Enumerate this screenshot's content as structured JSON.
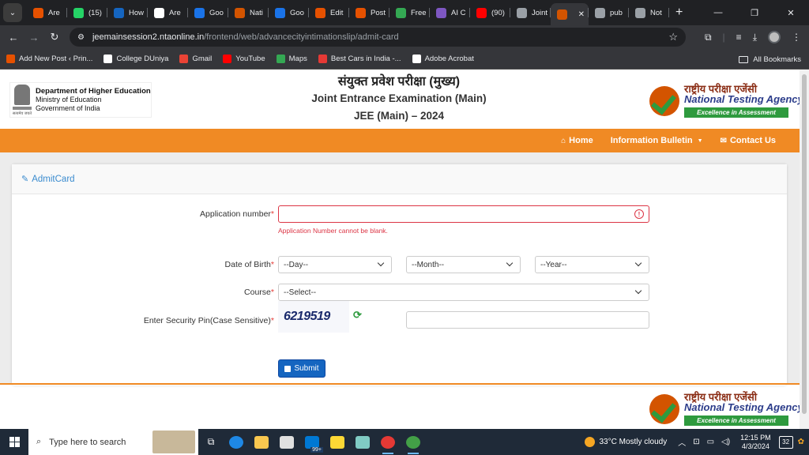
{
  "browser": {
    "tabs": [
      {
        "label": "Are",
        "icon": "blogger-icon",
        "color": "#e65100"
      },
      {
        "label": "(15)",
        "icon": "whatsapp-icon",
        "color": "#25d366"
      },
      {
        "label": "How",
        "icon": "bui-icon",
        "color": "#1565c0"
      },
      {
        "label": "Are",
        "icon": "google-icon",
        "color": "#ffffff"
      },
      {
        "label": "Goo",
        "icon": "docs-icon",
        "color": "#1a73e8"
      },
      {
        "label": "Nati",
        "icon": "nta-icon",
        "color": "#d35400"
      },
      {
        "label": "Goo",
        "icon": "docs-icon",
        "color": "#1a73e8"
      },
      {
        "label": "Edit",
        "icon": "blogger-icon",
        "color": "#e65100"
      },
      {
        "label": "Post",
        "icon": "blogger-icon",
        "color": "#e65100"
      },
      {
        "label": "Free",
        "icon": "free-icon",
        "color": "#34a853"
      },
      {
        "label": "AI C",
        "icon": "ai-icon",
        "color": "#7e57c2"
      },
      {
        "label": "(90)",
        "icon": "youtube-icon",
        "color": "#ff0000"
      },
      {
        "label": "Joint",
        "icon": "globe-icon",
        "color": "#9aa0a6"
      }
    ],
    "active_tab": {
      "label": "",
      "icon": "nta-icon",
      "color": "#d35400"
    },
    "tabs_after": [
      {
        "label": "pub",
        "icon": "globe-icon",
        "color": "#9aa0a6"
      },
      {
        "label": "Not",
        "icon": "globe-icon",
        "color": "#9aa0a6"
      }
    ],
    "new_tab": "+",
    "url_host": "jeemainsession2.ntaonline.in",
    "url_path": "/frontend/web/advancecityintimationslip/admit-card",
    "bookmarks": [
      {
        "label": "Add New Post ‹ Prin...",
        "color": "#e65100"
      },
      {
        "label": "College DUniya",
        "color": "#ffffff"
      },
      {
        "label": "Gmail",
        "color": "#ea4335"
      },
      {
        "label": "YouTube",
        "color": "#ff0000"
      },
      {
        "label": "Maps",
        "color": "#34a853"
      },
      {
        "label": "Best Cars in India -...",
        "color": "#e53935"
      },
      {
        "label": "Adobe Acrobat",
        "color": "#ffffff"
      }
    ],
    "all_bookmarks": "All Bookmarks"
  },
  "header": {
    "dept_title": "Department of Higher Education",
    "dept_line2": "Ministry of Education",
    "dept_line3": "Government of India",
    "title_hindi": "संयुक्त प्रवेश परीक्षा (मुख्य)",
    "title_english": "Joint Entrance Examination (Main)",
    "title_year": "JEE (Main) – 2024",
    "nta_hindi": "राष्ट्रीय परीक्षा एजेंसी",
    "nta_english": "National Testing Agency",
    "nta_tagline": "Excellence in Assessment"
  },
  "nav": {
    "home": "Home",
    "info": "Information Bulletin",
    "contact": "Contact Us"
  },
  "form": {
    "card_title": "AdmitCard",
    "app_label": "Application number",
    "app_value": "",
    "app_error": "Application Number cannot be blank.",
    "dob_label": "Date of Birth",
    "day": "--Day--",
    "month": "--Month--",
    "year": "--Year--",
    "course_label": "Course",
    "course": "--Select--",
    "pin_label": "Enter Security Pin(Case Sensitive)",
    "captcha": "6219519",
    "pin_value": "",
    "submit": "Submit",
    "required_mark": "*"
  },
  "taskbar": {
    "search_placeholder": "Type here to search",
    "weather": "33°C  Mostly cloudy",
    "time": "12:15 PM",
    "date": "4/3/2024",
    "notifications": "32",
    "badge": "99+",
    "accent": "#1f2a38"
  }
}
